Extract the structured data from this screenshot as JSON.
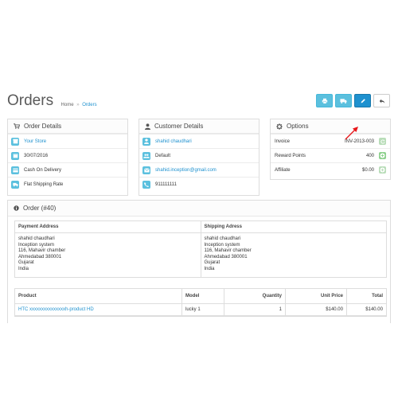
{
  "header": {
    "title": "Orders",
    "breadcrumb": {
      "home": "Home",
      "separator": "»",
      "current": "Orders"
    }
  },
  "toolbar": {
    "buttons": [
      {
        "icon": "print-icon"
      },
      {
        "icon": "truck-icon"
      },
      {
        "icon": "pencil-icon"
      },
      {
        "icon": "reply-icon"
      }
    ]
  },
  "order_details": {
    "title": "Order Details",
    "store": "Your Store",
    "date": "30/07/2016",
    "payment": "Cash On Delivery",
    "shipping": "Flat Shipping Rate"
  },
  "customer_details": {
    "title": "Customer Details",
    "name": "shahid chaudhari",
    "group": "Default",
    "email": "shahid.inception@gmail.com",
    "phone": "911111111"
  },
  "options": {
    "title": "Options",
    "rows": [
      {
        "label": "Invoice",
        "value": "INV-2013-003"
      },
      {
        "label": "Reward Points",
        "value": "400"
      },
      {
        "label": "Affiliate",
        "value": "$0.00"
      }
    ]
  },
  "order": {
    "title": "Order (#40)",
    "payment_address": {
      "heading": "Payment Address",
      "lines": [
        "shahid chaudhari",
        "Inception system",
        "116, Mahavir chamber",
        "Ahmedabad 380001",
        "Gujarat",
        "India"
      ]
    },
    "shipping_address": {
      "heading": "Shipping Adress",
      "lines": [
        "shahid chaudhari",
        "Inception system",
        "116, Mahavir chamber",
        "Ahmedabad 380001",
        "Gujarat",
        "India"
      ]
    },
    "products": {
      "columns": [
        "Product",
        "Model",
        "Quantity",
        "Unit Price",
        "Total"
      ],
      "rows": [
        {
          "product": "HTC xxxxxxxxxxxxxxxh-product HD",
          "model": "lucky 1",
          "quantity": "1",
          "unit_price": "$140.00",
          "total": "$140.00"
        }
      ]
    }
  },
  "colors": {
    "accent": "#1e91cf",
    "info": "#5bc0de",
    "success": "#8fd18f",
    "arrow": "#e8161a"
  }
}
